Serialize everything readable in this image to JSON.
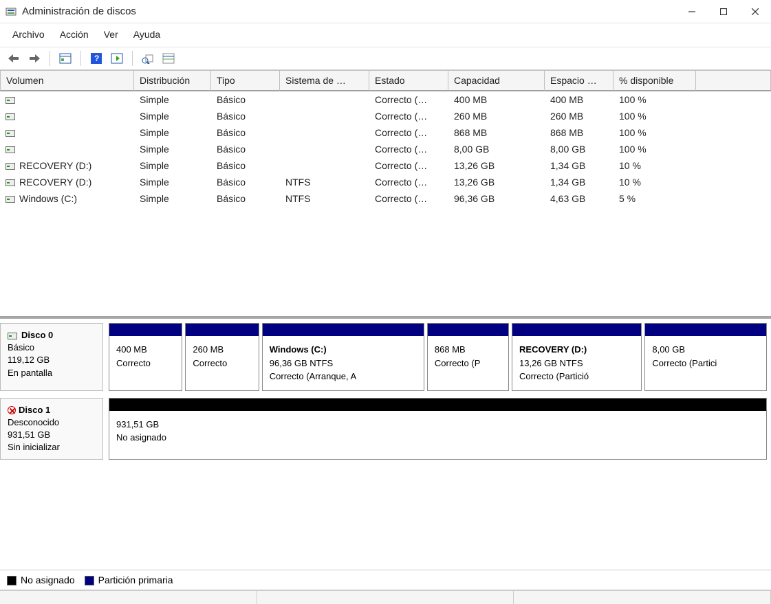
{
  "window": {
    "title": "Administración de discos"
  },
  "menu": {
    "file": "Archivo",
    "action": "Acción",
    "view": "Ver",
    "help": "Ayuda"
  },
  "columns": {
    "volume": "Volumen",
    "layout": "Distribución",
    "type": "Tipo",
    "fs": "Sistema de …",
    "state": "Estado",
    "capacity": "Capacidad",
    "free": "Espacio …",
    "pct": "% disponible"
  },
  "volumes": [
    {
      "name": "",
      "layout": "Simple",
      "type": "Básico",
      "fs": "",
      "state": "Correcto (…",
      "capacity": "400 MB",
      "free": "400 MB",
      "pct": "100 %"
    },
    {
      "name": "",
      "layout": "Simple",
      "type": "Básico",
      "fs": "",
      "state": "Correcto (…",
      "capacity": "260 MB",
      "free": "260 MB",
      "pct": "100 %"
    },
    {
      "name": "",
      "layout": "Simple",
      "type": "Básico",
      "fs": "",
      "state": "Correcto (…",
      "capacity": "868 MB",
      "free": "868 MB",
      "pct": "100 %"
    },
    {
      "name": "",
      "layout": "Simple",
      "type": "Básico",
      "fs": "",
      "state": "Correcto (…",
      "capacity": "8,00 GB",
      "free": "8,00 GB",
      "pct": "100 %"
    },
    {
      "name": "RECOVERY (D:)",
      "layout": "Simple",
      "type": "Básico",
      "fs": "",
      "state": "Correcto (…",
      "capacity": "13,26 GB",
      "free": "1,34 GB",
      "pct": "10 %"
    },
    {
      "name": "RECOVERY (D:)",
      "layout": "Simple",
      "type": "Básico",
      "fs": "NTFS",
      "state": "Correcto (…",
      "capacity": "13,26 GB",
      "free": "1,34 GB",
      "pct": "10 %"
    },
    {
      "name": "Windows (C:)",
      "layout": "Simple",
      "type": "Básico",
      "fs": "NTFS",
      "state": "Correcto (…",
      "capacity": "96,36 GB",
      "free": "4,63 GB",
      "pct": "5 %"
    }
  ],
  "disks": [
    {
      "title": "Disco 0",
      "type": "Básico",
      "size": "119,12 GB",
      "status": "En pantalla",
      "error": false,
      "partitions": [
        {
          "name": "",
          "detail": "400 MB",
          "status": "Correcto",
          "stripe": "primary",
          "flex": 0.9
        },
        {
          "name": "",
          "detail": "260 MB",
          "status": "Correcto",
          "stripe": "primary",
          "flex": 0.9
        },
        {
          "name": "Windows  (C:)",
          "detail": "96,36 GB NTFS",
          "status": "Correcto (Arranque, A",
          "stripe": "primary",
          "flex": 2.0
        },
        {
          "name": "",
          "detail": "868 MB",
          "status": "Correcto (P",
          "stripe": "primary",
          "flex": 1.0
        },
        {
          "name": "RECOVERY  (D:)",
          "detail": "13,26 GB NTFS",
          "status": "Correcto (Partició",
          "stripe": "primary",
          "flex": 1.6
        },
        {
          "name": "",
          "detail": "8,00 GB",
          "status": "Correcto (Partici",
          "stripe": "primary",
          "flex": 1.5
        }
      ]
    },
    {
      "title": "Disco 1",
      "type": "Desconocido",
      "size": "931,51 GB",
      "status": "Sin inicializar",
      "error": true,
      "partitions": [
        {
          "name": "",
          "detail": "931,51 GB",
          "status": "No asignado",
          "stripe": "unalloc",
          "flex": 1
        }
      ]
    }
  ],
  "legend": {
    "unallocated": "No asignado",
    "primary": "Partición primaria"
  }
}
